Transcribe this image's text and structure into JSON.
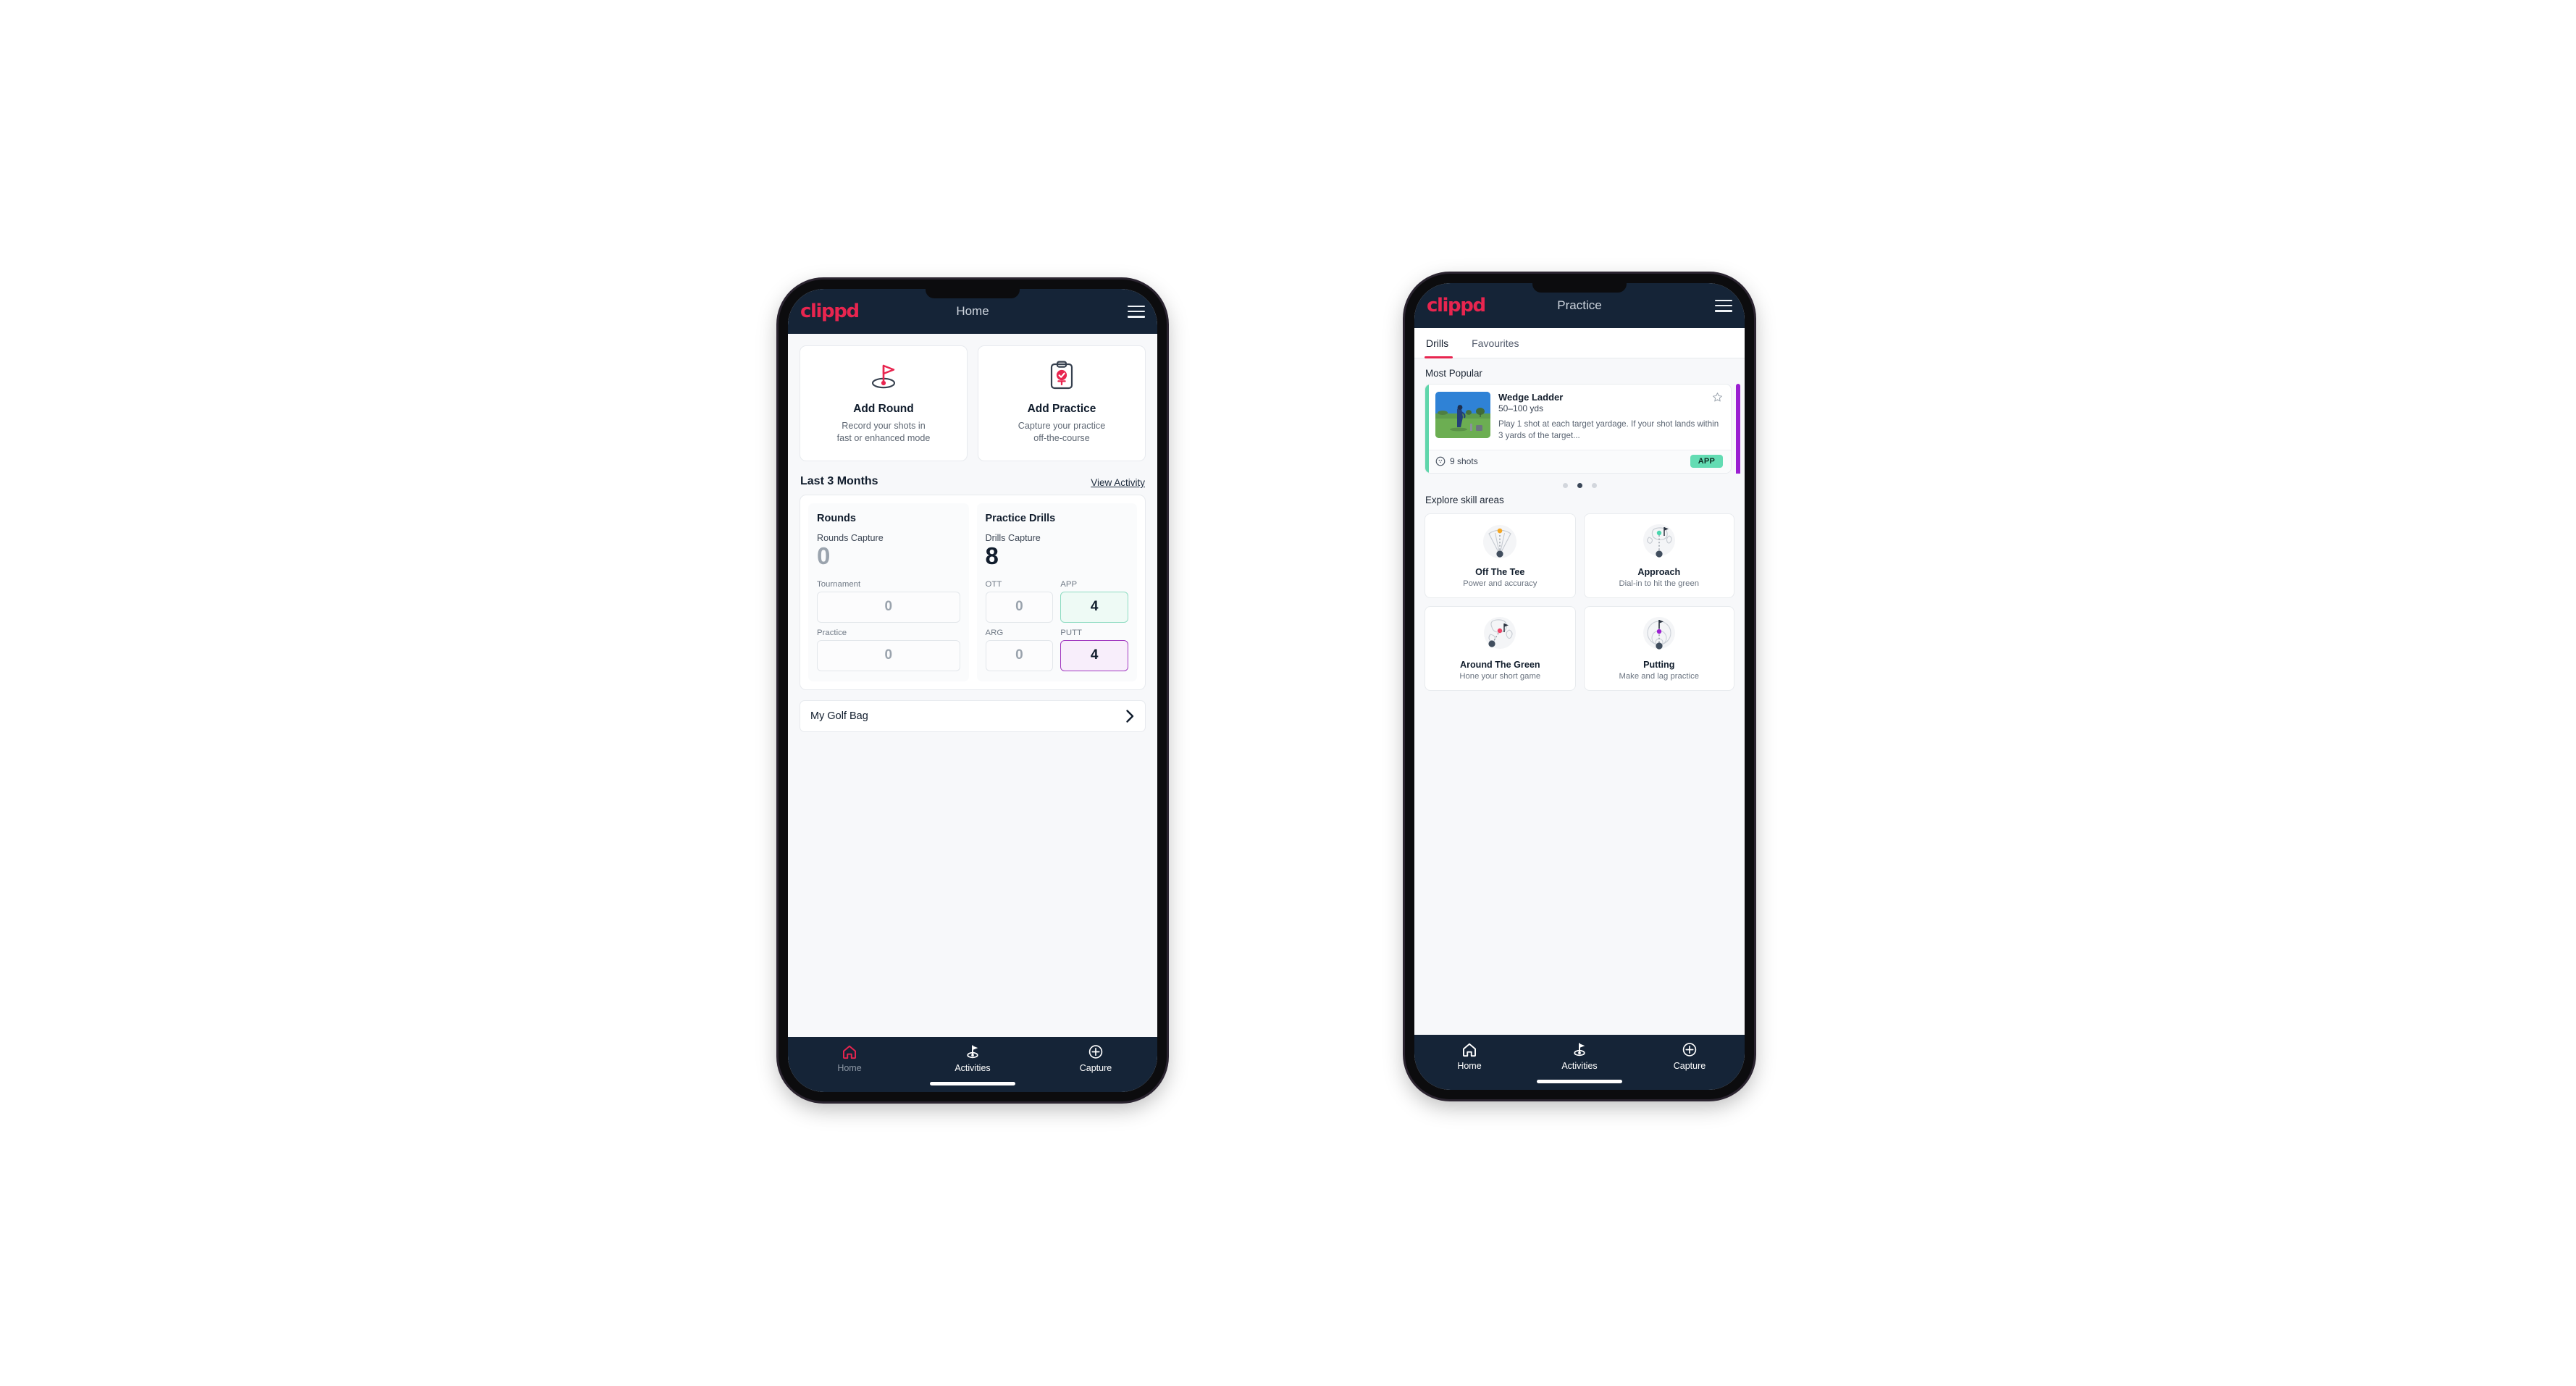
{
  "colors": {
    "brand_pink": "#e8254f",
    "navy": "#152437",
    "app_green": "#63dcb3",
    "putt_purple": "#a23bc0",
    "peek_purple": "#9b1fd1",
    "page_bg": "#f7f8fa"
  },
  "phone_home": {
    "appbar": {
      "logo": "clippd",
      "title": "Home",
      "menu_icon": "hamburger-icon"
    },
    "quick_actions": [
      {
        "icon": "golf-flag-icon",
        "title": "Add Round",
        "subtitle_line1": "Record your shots in",
        "subtitle_line2": "fast or enhanced mode"
      },
      {
        "icon": "clipboard-check-icon",
        "title": "Add Practice",
        "subtitle_line1": "Capture your practice",
        "subtitle_line2": "off-the-course"
      }
    ],
    "section": {
      "title": "Last 3 Months",
      "link": "View Activity"
    },
    "stats": {
      "rounds": {
        "heading": "Rounds",
        "capture_label": "Rounds Capture",
        "capture_value": "0",
        "tiles": [
          {
            "label": "Tournament",
            "value": "0",
            "state": "empty"
          },
          {
            "label": "Practice",
            "value": "0",
            "state": "empty"
          }
        ]
      },
      "drills": {
        "heading": "Practice Drills",
        "capture_label": "Drills Capture",
        "capture_value": "8",
        "tiles": [
          {
            "label": "OTT",
            "value": "0",
            "state": "empty"
          },
          {
            "label": "APP",
            "value": "4",
            "state": "app"
          },
          {
            "label": "ARG",
            "value": "0",
            "state": "empty"
          },
          {
            "label": "PUTT",
            "value": "4",
            "state": "putt"
          }
        ]
      }
    },
    "golf_bag": {
      "label": "My Golf Bag",
      "chevron": "chevron-right-icon"
    },
    "bottom_nav": [
      {
        "icon": "home-icon",
        "label": "Home",
        "active": true
      },
      {
        "icon": "golf-flag-nav-icon",
        "label": "Activities",
        "active": false
      },
      {
        "icon": "plus-circle-icon",
        "label": "Capture",
        "active": false
      }
    ]
  },
  "phone_practice": {
    "appbar": {
      "logo": "clippd",
      "title": "Practice",
      "menu_icon": "hamburger-icon"
    },
    "tabs": [
      {
        "label": "Drills",
        "active": true
      },
      {
        "label": "Favourites",
        "active": false
      }
    ],
    "most_popular_label": "Most Popular",
    "drill_card": {
      "thumbnail": "golfer-photo",
      "name": "Wedge Ladder",
      "yardage": "50–100 yds",
      "description": "Play 1 shot at each target yardage. If your shot lands within 3 yards of the target...",
      "favourite_icon": "star-outline-icon",
      "shots_icon": "golf-ball-icon",
      "shots_text": "9 shots",
      "badge": "APP"
    },
    "carousel_dots": {
      "count": 3,
      "active_index": 1
    },
    "skill_areas_label": "Explore skill areas",
    "skill_areas": [
      {
        "icon": "off-the-tee-icon",
        "title": "Off The Tee",
        "subtitle": "Power and accuracy"
      },
      {
        "icon": "approach-icon",
        "title": "Approach",
        "subtitle": "Dial-in to hit the green"
      },
      {
        "icon": "around-the-green-icon",
        "title": "Around The Green",
        "subtitle": "Hone your short game"
      },
      {
        "icon": "putting-icon",
        "title": "Putting",
        "subtitle": "Make and lag practice"
      }
    ],
    "bottom_nav": [
      {
        "icon": "home-icon",
        "label": "Home",
        "active": false
      },
      {
        "icon": "golf-flag-nav-icon",
        "label": "Activities",
        "active": true
      },
      {
        "icon": "plus-circle-icon",
        "label": "Capture",
        "active": false
      }
    ]
  }
}
